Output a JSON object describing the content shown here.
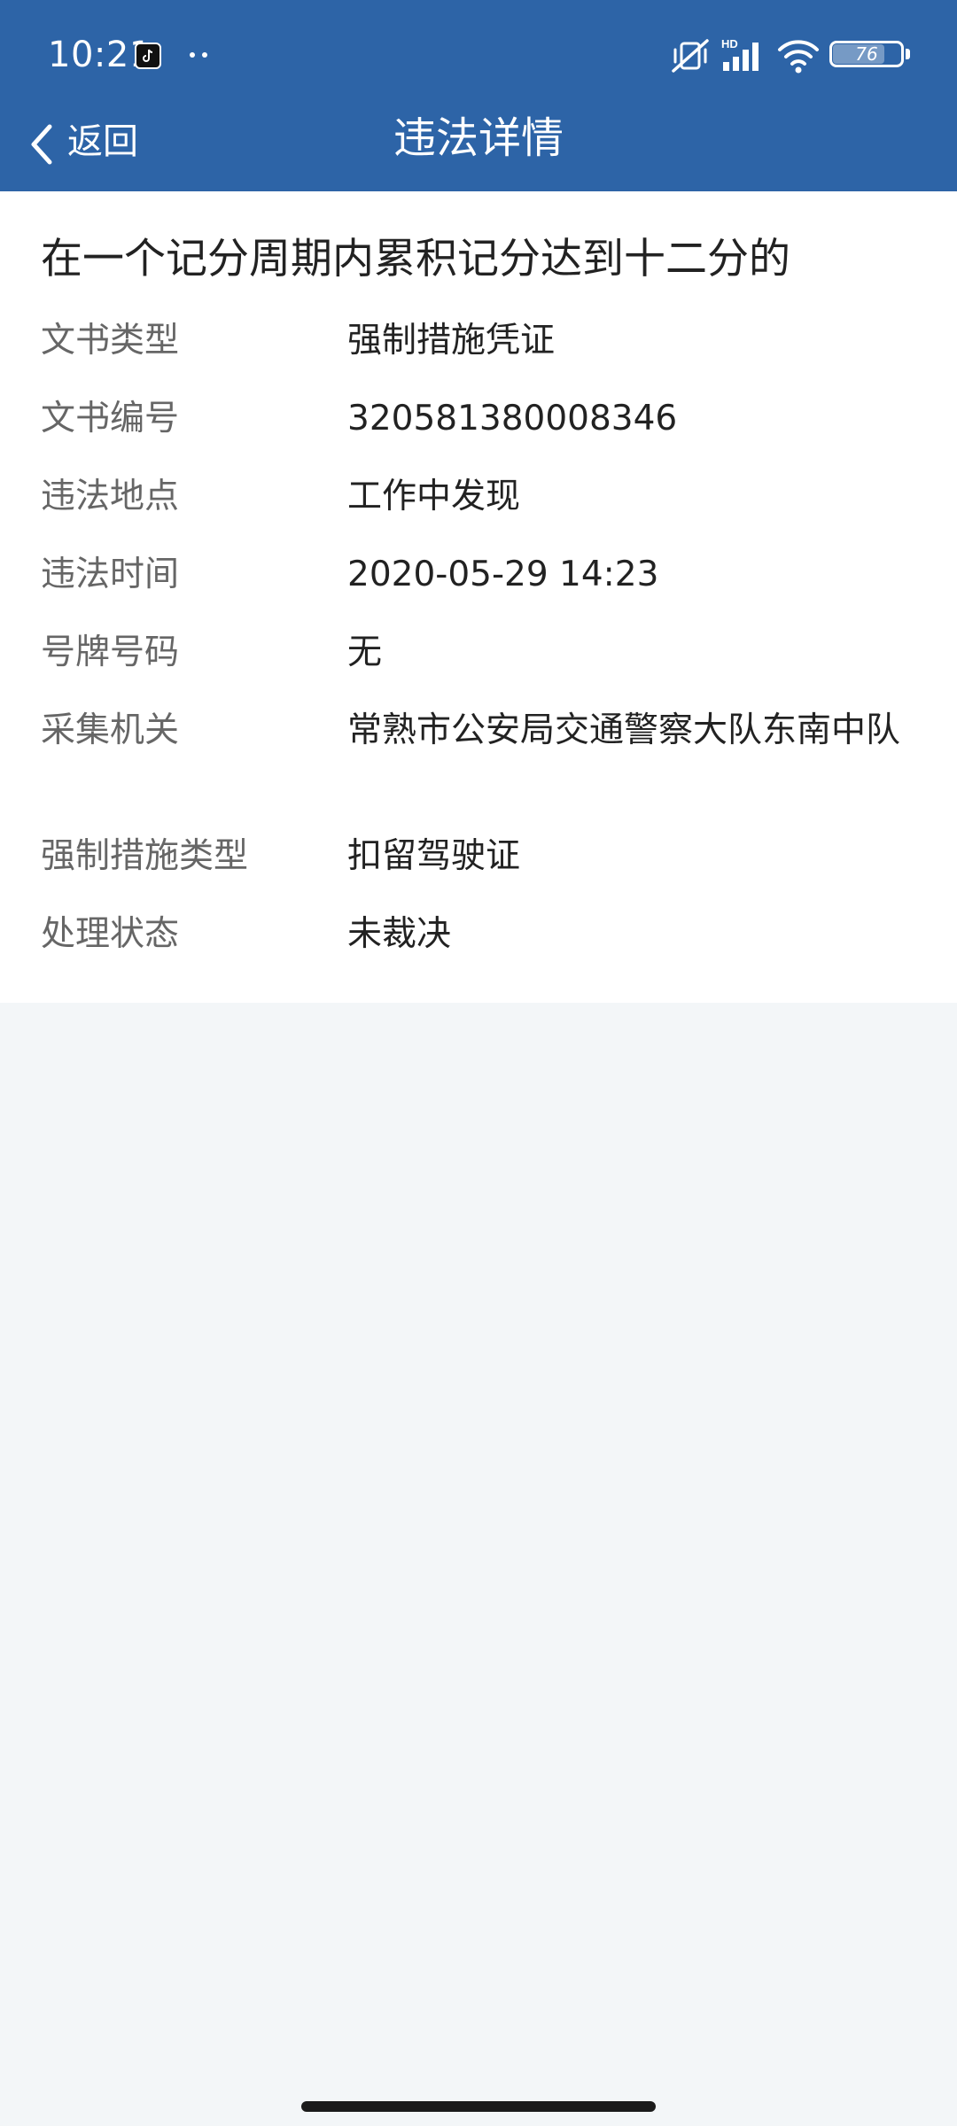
{
  "status_bar": {
    "time": "10:21",
    "app_icon": "tiktok-icon",
    "more_icon": "dots-icon",
    "mute_icon": "vibrate-mute-icon",
    "network_label": "HD",
    "signal_icon": "signal-icon",
    "wifi_icon": "wifi-icon",
    "battery_level": "76",
    "battery_fraction": 0.76
  },
  "nav": {
    "back_icon": "chevron-left-icon",
    "back_label": "返回",
    "title": "违法详情"
  },
  "detail": {
    "title": "在一个记分周期内累积记分达到十二分的",
    "rows": [
      {
        "label": "文书类型",
        "value": "强制措施凭证"
      },
      {
        "label": "文书编号",
        "value": "320581380008346"
      },
      {
        "label": "违法地点",
        "value": "工作中发现"
      },
      {
        "label": "违法时间",
        "value": "2020-05-29 14:23"
      },
      {
        "label": "号牌号码",
        "value": "无"
      },
      {
        "label": "采集机关",
        "value": "常熟市公安局交通警察大队东南中队"
      },
      {
        "label": "强制措施类型",
        "value": "扣留驾驶证"
      },
      {
        "label": "处理状态",
        "value": "未裁决"
      }
    ]
  },
  "colors": {
    "header": "#2d64a7",
    "page_background": "#f3f6f8",
    "card_background": "#ffffff",
    "label_text": "#666666",
    "value_text": "#222222"
  }
}
